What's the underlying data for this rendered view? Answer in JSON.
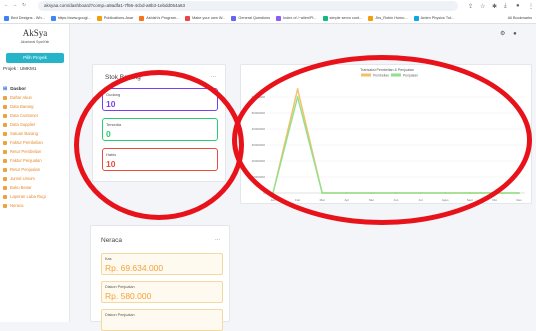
{
  "browser": {
    "url": "aksyaa.com/dashboard?comp=a9adfa1-7f66-4cbd-a8b3-1ebdd054a63",
    "bookmarks": [
      "Bed Designs - Wh...",
      "https://www.googl...",
      "Publications-Asar",
      "Ashish's Program...",
      "Make your own W...",
      "General Questions",
      "Index of /~allen/Pl...",
      "simple servo cont...",
      "Jhs_Robin Homo...",
      "Arden Physics Tut..."
    ],
    "all_bookmarks": "All Bookmarks"
  },
  "sidebar": {
    "brand": "AkSya",
    "brand_sub": "Akuntansi SyariYah",
    "pilih_button": "Pilih Proyek",
    "proyek_label": "Projek : UMKM1",
    "menu": [
      "Dasbor",
      "Daftar Akun",
      "Data Barang",
      "Data Customer",
      "Data Supplier",
      "Satuan Barang",
      "Faktur Pembelian",
      "Retur Pembelian",
      "Faktur Penjualan",
      "Retur Penjualan",
      "Jurnal Umum",
      "Buku Besar",
      "Laporan Laba Rugi",
      "Neraca"
    ]
  },
  "stok": {
    "title": "Stok Barang",
    "dots": "...",
    "items": [
      {
        "label": "Gudang",
        "value": "10",
        "color": "#7b3ff2"
      },
      {
        "label": "Tersedia",
        "value": "0",
        "color": "#2ecc71"
      },
      {
        "label": "Habis",
        "value": "10",
        "color": "#e74c3c"
      }
    ]
  },
  "chart_data": {
    "type": "line",
    "title": "Transaksi Pembelian & Penjualan",
    "categories": [
      "Jan",
      "Feb",
      "Mar",
      "Apr",
      "Mei",
      "Jun",
      "Jul",
      "Agus",
      "Sept",
      "Okt",
      "Des"
    ],
    "yticks": [
      "0",
      "10000000",
      "20000000",
      "30000000",
      "40000000",
      "50000000",
      "60000000"
    ],
    "ylim": [
      0,
      70000000
    ],
    "series": [
      {
        "name": "Pembelian",
        "color": "#f5c065",
        "values": [
          0,
          65000000,
          0,
          0,
          0,
          0,
          0,
          0,
          0,
          0,
          0
        ]
      },
      {
        "name": "Penjualan",
        "color": "#8fe08f",
        "values": [
          0,
          60000000,
          0,
          0,
          0,
          0,
          0,
          0,
          0,
          0,
          0
        ]
      }
    ]
  },
  "neraca": {
    "title": "Neraca",
    "dots": "...",
    "items": [
      {
        "label": "Kas",
        "value": "Rp. 69.634.000"
      },
      {
        "label": "Diskon Penjualan",
        "value": "Rp. 580.000"
      },
      {
        "label": "Diskon Penjualan",
        "value": ""
      }
    ]
  },
  "colors": {
    "accent": "#26b5c8",
    "menu": "#e68a2e",
    "annotation": "#e8121a"
  }
}
